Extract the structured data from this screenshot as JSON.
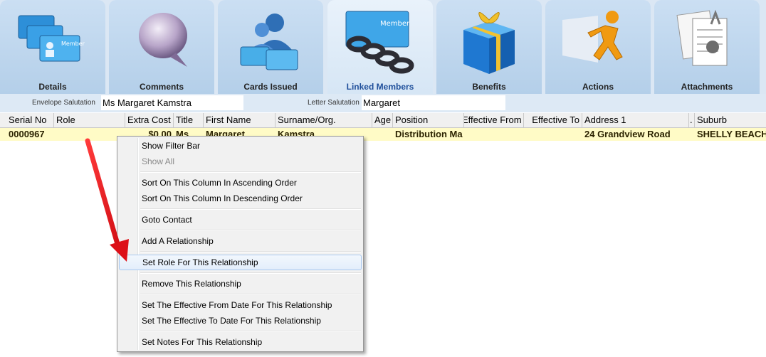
{
  "tabs": [
    {
      "label": "Details",
      "icon": "member-cards-icon"
    },
    {
      "label": "Comments",
      "icon": "speech-bubble-icon"
    },
    {
      "label": "Cards Issued",
      "icon": "members-cards-icon"
    },
    {
      "label": "Linked Members",
      "icon": "chain-link-icon"
    },
    {
      "label": "Benefits",
      "icon": "gift-box-icon"
    },
    {
      "label": "Actions",
      "icon": "running-man-icon"
    },
    {
      "label": "Attachments",
      "icon": "attached-documents-icon"
    }
  ],
  "active_tab": "Linked Members",
  "salutations": {
    "envelope_label": "Envelope Salutation",
    "envelope_value": "Ms Margaret Kamstra",
    "letter_label": "Letter Salutation",
    "letter_value": "Margaret"
  },
  "grid": {
    "columns": [
      "Serial No",
      "Role",
      "Extra Cost",
      "Title",
      "First Name",
      "Surname/Org.",
      "Age",
      "Position",
      "Effective From",
      "Effective To",
      "Address 1",
      ".",
      "Suburb"
    ],
    "rows": [
      {
        "serial_no": "0000967",
        "role": "",
        "extra_cost": "$0.00",
        "title": "Ms",
        "first_name": "Margaret",
        "surname": "Kamstra",
        "age": "",
        "position": "Distribution Ma",
        "effective_from": "",
        "effective_to": "",
        "address1": "24 Grandview Road",
        "dot": "",
        "suburb": "SHELLY BEACH"
      }
    ]
  },
  "context_menu": {
    "items": [
      {
        "label": "Show Filter Bar",
        "enabled": true
      },
      {
        "label": "Show All",
        "enabled": false
      },
      {
        "label": "Sort On This Column In Ascending Order",
        "enabled": true
      },
      {
        "label": "Sort On This Column In Descending Order",
        "enabled": true
      },
      {
        "label": "Goto Contact",
        "enabled": true
      },
      {
        "label": "Add A Relationship",
        "enabled": true
      },
      {
        "label": "Set Role For This Relationship",
        "enabled": true,
        "highlighted": true
      },
      {
        "label": "Remove This Relationship",
        "enabled": true
      },
      {
        "label": "Set The Effective From Date For This Relationship",
        "enabled": true
      },
      {
        "label": "Set The Effective To Date For This Relationship",
        "enabled": true
      },
      {
        "label": "Set Notes For This Relationship",
        "enabled": true
      }
    ]
  },
  "annotation": {
    "arrow_color": "#e8141b"
  }
}
